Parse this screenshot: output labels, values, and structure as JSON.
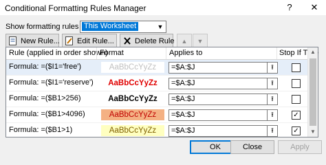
{
  "window": {
    "title": "Conditional Formatting Rules Manager",
    "help": "?",
    "close": "✕"
  },
  "show": {
    "label": "Show formatting rules for:",
    "value": "This Worksheet"
  },
  "toolbar": {
    "new_rule": "New Rule...",
    "edit_rule": "Edit Rule...",
    "delete_rule": "Delete Rule"
  },
  "table": {
    "headers": [
      "Rule (applied in order shown)",
      "Format",
      "Applies to",
      "Stop If True"
    ],
    "rows": [
      {
        "rule": "Formula: =($I1='free')",
        "preview": "AaBbCcYyZz",
        "applies": "=$A:$J",
        "stop": false,
        "fill": "#ffffff",
        "color": "#c0c0c0",
        "bold": false
      },
      {
        "rule": "Formula: =($I1='reserve')",
        "preview": "AaBbCcYyZz",
        "applies": "=$A:$J",
        "stop": false,
        "fill": "#ffffff",
        "color": "#e00000",
        "bold": true
      },
      {
        "rule": "Formula: =($B1>256)",
        "preview": "AaBbCcYyZz",
        "applies": "=$A:$J",
        "stop": false,
        "fill": "#ffffff",
        "color": "#000000",
        "bold": true
      },
      {
        "rule": "Formula: =($B1>4096)",
        "preview": "AaBbCcYyZz",
        "applies": "=$A:$J",
        "stop": true,
        "fill": "#f4b183",
        "color": "#c00000",
        "bold": false
      },
      {
        "rule": "Formula: =($B1>1)",
        "preview": "AaBbCcYyZz",
        "applies": "=$A:$J",
        "stop": true,
        "fill": "#ffffc0",
        "color": "#806000",
        "bold": false
      }
    ]
  },
  "buttons": {
    "ok": "OK",
    "close": "Close",
    "apply": "Apply"
  },
  "colors": {
    "accent": "#0078d7",
    "selected_row": "#e5eef9"
  }
}
